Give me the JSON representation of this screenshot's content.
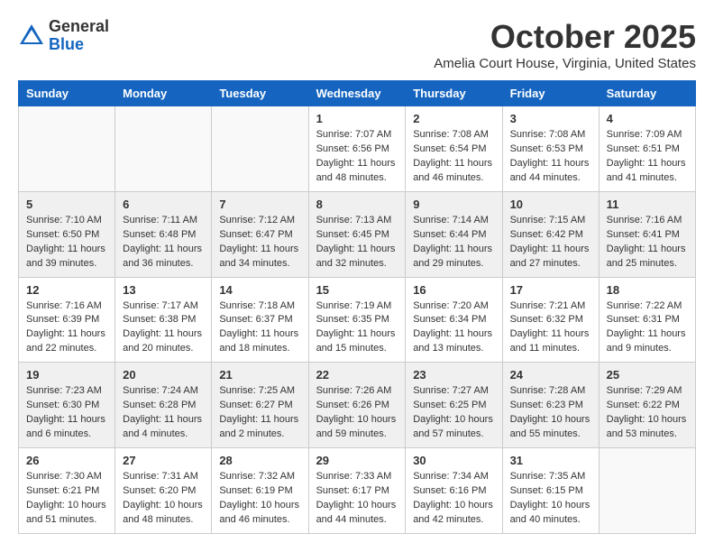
{
  "header": {
    "logo_general": "General",
    "logo_blue": "Blue",
    "month_title": "October 2025",
    "subtitle": "Amelia Court House, Virginia, United States"
  },
  "weekdays": [
    "Sunday",
    "Monday",
    "Tuesday",
    "Wednesday",
    "Thursday",
    "Friday",
    "Saturday"
  ],
  "weeks": [
    [
      {
        "day": "",
        "info": ""
      },
      {
        "day": "",
        "info": ""
      },
      {
        "day": "",
        "info": ""
      },
      {
        "day": "1",
        "info": "Sunrise: 7:07 AM\nSunset: 6:56 PM\nDaylight: 11 hours\nand 48 minutes."
      },
      {
        "day": "2",
        "info": "Sunrise: 7:08 AM\nSunset: 6:54 PM\nDaylight: 11 hours\nand 46 minutes."
      },
      {
        "day": "3",
        "info": "Sunrise: 7:08 AM\nSunset: 6:53 PM\nDaylight: 11 hours\nand 44 minutes."
      },
      {
        "day": "4",
        "info": "Sunrise: 7:09 AM\nSunset: 6:51 PM\nDaylight: 11 hours\nand 41 minutes."
      }
    ],
    [
      {
        "day": "5",
        "info": "Sunrise: 7:10 AM\nSunset: 6:50 PM\nDaylight: 11 hours\nand 39 minutes."
      },
      {
        "day": "6",
        "info": "Sunrise: 7:11 AM\nSunset: 6:48 PM\nDaylight: 11 hours\nand 36 minutes."
      },
      {
        "day": "7",
        "info": "Sunrise: 7:12 AM\nSunset: 6:47 PM\nDaylight: 11 hours\nand 34 minutes."
      },
      {
        "day": "8",
        "info": "Sunrise: 7:13 AM\nSunset: 6:45 PM\nDaylight: 11 hours\nand 32 minutes."
      },
      {
        "day": "9",
        "info": "Sunrise: 7:14 AM\nSunset: 6:44 PM\nDaylight: 11 hours\nand 29 minutes."
      },
      {
        "day": "10",
        "info": "Sunrise: 7:15 AM\nSunset: 6:42 PM\nDaylight: 11 hours\nand 27 minutes."
      },
      {
        "day": "11",
        "info": "Sunrise: 7:16 AM\nSunset: 6:41 PM\nDaylight: 11 hours\nand 25 minutes."
      }
    ],
    [
      {
        "day": "12",
        "info": "Sunrise: 7:16 AM\nSunset: 6:39 PM\nDaylight: 11 hours\nand 22 minutes."
      },
      {
        "day": "13",
        "info": "Sunrise: 7:17 AM\nSunset: 6:38 PM\nDaylight: 11 hours\nand 20 minutes."
      },
      {
        "day": "14",
        "info": "Sunrise: 7:18 AM\nSunset: 6:37 PM\nDaylight: 11 hours\nand 18 minutes."
      },
      {
        "day": "15",
        "info": "Sunrise: 7:19 AM\nSunset: 6:35 PM\nDaylight: 11 hours\nand 15 minutes."
      },
      {
        "day": "16",
        "info": "Sunrise: 7:20 AM\nSunset: 6:34 PM\nDaylight: 11 hours\nand 13 minutes."
      },
      {
        "day": "17",
        "info": "Sunrise: 7:21 AM\nSunset: 6:32 PM\nDaylight: 11 hours\nand 11 minutes."
      },
      {
        "day": "18",
        "info": "Sunrise: 7:22 AM\nSunset: 6:31 PM\nDaylight: 11 hours\nand 9 minutes."
      }
    ],
    [
      {
        "day": "19",
        "info": "Sunrise: 7:23 AM\nSunset: 6:30 PM\nDaylight: 11 hours\nand 6 minutes."
      },
      {
        "day": "20",
        "info": "Sunrise: 7:24 AM\nSunset: 6:28 PM\nDaylight: 11 hours\nand 4 minutes."
      },
      {
        "day": "21",
        "info": "Sunrise: 7:25 AM\nSunset: 6:27 PM\nDaylight: 11 hours\nand 2 minutes."
      },
      {
        "day": "22",
        "info": "Sunrise: 7:26 AM\nSunset: 6:26 PM\nDaylight: 10 hours\nand 59 minutes."
      },
      {
        "day": "23",
        "info": "Sunrise: 7:27 AM\nSunset: 6:25 PM\nDaylight: 10 hours\nand 57 minutes."
      },
      {
        "day": "24",
        "info": "Sunrise: 7:28 AM\nSunset: 6:23 PM\nDaylight: 10 hours\nand 55 minutes."
      },
      {
        "day": "25",
        "info": "Sunrise: 7:29 AM\nSunset: 6:22 PM\nDaylight: 10 hours\nand 53 minutes."
      }
    ],
    [
      {
        "day": "26",
        "info": "Sunrise: 7:30 AM\nSunset: 6:21 PM\nDaylight: 10 hours\nand 51 minutes."
      },
      {
        "day": "27",
        "info": "Sunrise: 7:31 AM\nSunset: 6:20 PM\nDaylight: 10 hours\nand 48 minutes."
      },
      {
        "day": "28",
        "info": "Sunrise: 7:32 AM\nSunset: 6:19 PM\nDaylight: 10 hours\nand 46 minutes."
      },
      {
        "day": "29",
        "info": "Sunrise: 7:33 AM\nSunset: 6:17 PM\nDaylight: 10 hours\nand 44 minutes."
      },
      {
        "day": "30",
        "info": "Sunrise: 7:34 AM\nSunset: 6:16 PM\nDaylight: 10 hours\nand 42 minutes."
      },
      {
        "day": "31",
        "info": "Sunrise: 7:35 AM\nSunset: 6:15 PM\nDaylight: 10 hours\nand 40 minutes."
      },
      {
        "day": "",
        "info": ""
      }
    ]
  ]
}
